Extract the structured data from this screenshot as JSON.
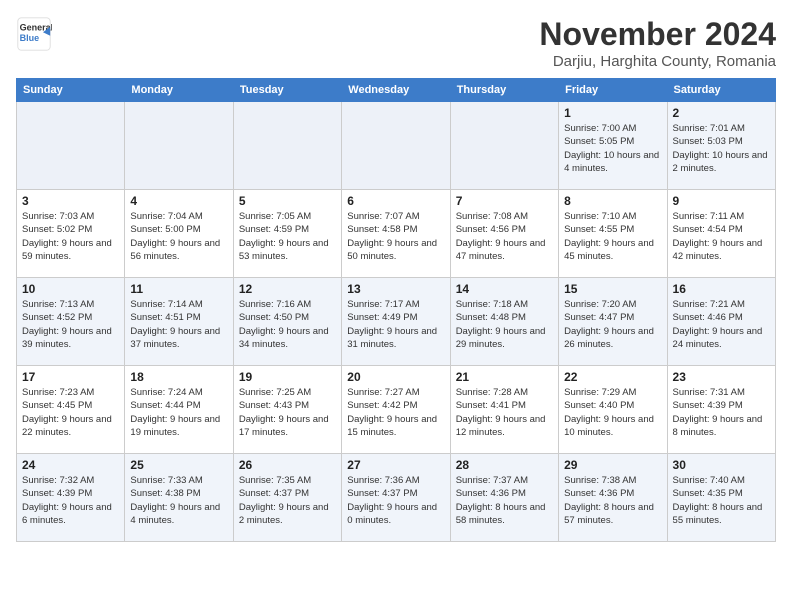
{
  "header": {
    "logo_line1": "General",
    "logo_line2": "Blue",
    "month": "November 2024",
    "location": "Darjiu, Harghita County, Romania"
  },
  "weekdays": [
    "Sunday",
    "Monday",
    "Tuesday",
    "Wednesday",
    "Thursday",
    "Friday",
    "Saturday"
  ],
  "weeks": [
    [
      {
        "day": "",
        "info": ""
      },
      {
        "day": "",
        "info": ""
      },
      {
        "day": "",
        "info": ""
      },
      {
        "day": "",
        "info": ""
      },
      {
        "day": "",
        "info": ""
      },
      {
        "day": "1",
        "info": "Sunrise: 7:00 AM\nSunset: 5:05 PM\nDaylight: 10 hours\nand 4 minutes."
      },
      {
        "day": "2",
        "info": "Sunrise: 7:01 AM\nSunset: 5:03 PM\nDaylight: 10 hours\nand 2 minutes."
      }
    ],
    [
      {
        "day": "3",
        "info": "Sunrise: 7:03 AM\nSunset: 5:02 PM\nDaylight: 9 hours\nand 59 minutes."
      },
      {
        "day": "4",
        "info": "Sunrise: 7:04 AM\nSunset: 5:00 PM\nDaylight: 9 hours\nand 56 minutes."
      },
      {
        "day": "5",
        "info": "Sunrise: 7:05 AM\nSunset: 4:59 PM\nDaylight: 9 hours\nand 53 minutes."
      },
      {
        "day": "6",
        "info": "Sunrise: 7:07 AM\nSunset: 4:58 PM\nDaylight: 9 hours\nand 50 minutes."
      },
      {
        "day": "7",
        "info": "Sunrise: 7:08 AM\nSunset: 4:56 PM\nDaylight: 9 hours\nand 47 minutes."
      },
      {
        "day": "8",
        "info": "Sunrise: 7:10 AM\nSunset: 4:55 PM\nDaylight: 9 hours\nand 45 minutes."
      },
      {
        "day": "9",
        "info": "Sunrise: 7:11 AM\nSunset: 4:54 PM\nDaylight: 9 hours\nand 42 minutes."
      }
    ],
    [
      {
        "day": "10",
        "info": "Sunrise: 7:13 AM\nSunset: 4:52 PM\nDaylight: 9 hours\nand 39 minutes."
      },
      {
        "day": "11",
        "info": "Sunrise: 7:14 AM\nSunset: 4:51 PM\nDaylight: 9 hours\nand 37 minutes."
      },
      {
        "day": "12",
        "info": "Sunrise: 7:16 AM\nSunset: 4:50 PM\nDaylight: 9 hours\nand 34 minutes."
      },
      {
        "day": "13",
        "info": "Sunrise: 7:17 AM\nSunset: 4:49 PM\nDaylight: 9 hours\nand 31 minutes."
      },
      {
        "day": "14",
        "info": "Sunrise: 7:18 AM\nSunset: 4:48 PM\nDaylight: 9 hours\nand 29 minutes."
      },
      {
        "day": "15",
        "info": "Sunrise: 7:20 AM\nSunset: 4:47 PM\nDaylight: 9 hours\nand 26 minutes."
      },
      {
        "day": "16",
        "info": "Sunrise: 7:21 AM\nSunset: 4:46 PM\nDaylight: 9 hours\nand 24 minutes."
      }
    ],
    [
      {
        "day": "17",
        "info": "Sunrise: 7:23 AM\nSunset: 4:45 PM\nDaylight: 9 hours\nand 22 minutes."
      },
      {
        "day": "18",
        "info": "Sunrise: 7:24 AM\nSunset: 4:44 PM\nDaylight: 9 hours\nand 19 minutes."
      },
      {
        "day": "19",
        "info": "Sunrise: 7:25 AM\nSunset: 4:43 PM\nDaylight: 9 hours\nand 17 minutes."
      },
      {
        "day": "20",
        "info": "Sunrise: 7:27 AM\nSunset: 4:42 PM\nDaylight: 9 hours\nand 15 minutes."
      },
      {
        "day": "21",
        "info": "Sunrise: 7:28 AM\nSunset: 4:41 PM\nDaylight: 9 hours\nand 12 minutes."
      },
      {
        "day": "22",
        "info": "Sunrise: 7:29 AM\nSunset: 4:40 PM\nDaylight: 9 hours\nand 10 minutes."
      },
      {
        "day": "23",
        "info": "Sunrise: 7:31 AM\nSunset: 4:39 PM\nDaylight: 9 hours\nand 8 minutes."
      }
    ],
    [
      {
        "day": "24",
        "info": "Sunrise: 7:32 AM\nSunset: 4:39 PM\nDaylight: 9 hours\nand 6 minutes."
      },
      {
        "day": "25",
        "info": "Sunrise: 7:33 AM\nSunset: 4:38 PM\nDaylight: 9 hours\nand 4 minutes."
      },
      {
        "day": "26",
        "info": "Sunrise: 7:35 AM\nSunset: 4:37 PM\nDaylight: 9 hours\nand 2 minutes."
      },
      {
        "day": "27",
        "info": "Sunrise: 7:36 AM\nSunset: 4:37 PM\nDaylight: 9 hours\nand 0 minutes."
      },
      {
        "day": "28",
        "info": "Sunrise: 7:37 AM\nSunset: 4:36 PM\nDaylight: 8 hours\nand 58 minutes."
      },
      {
        "day": "29",
        "info": "Sunrise: 7:38 AM\nSunset: 4:36 PM\nDaylight: 8 hours\nand 57 minutes."
      },
      {
        "day": "30",
        "info": "Sunrise: 7:40 AM\nSunset: 4:35 PM\nDaylight: 8 hours\nand 55 minutes."
      }
    ]
  ]
}
